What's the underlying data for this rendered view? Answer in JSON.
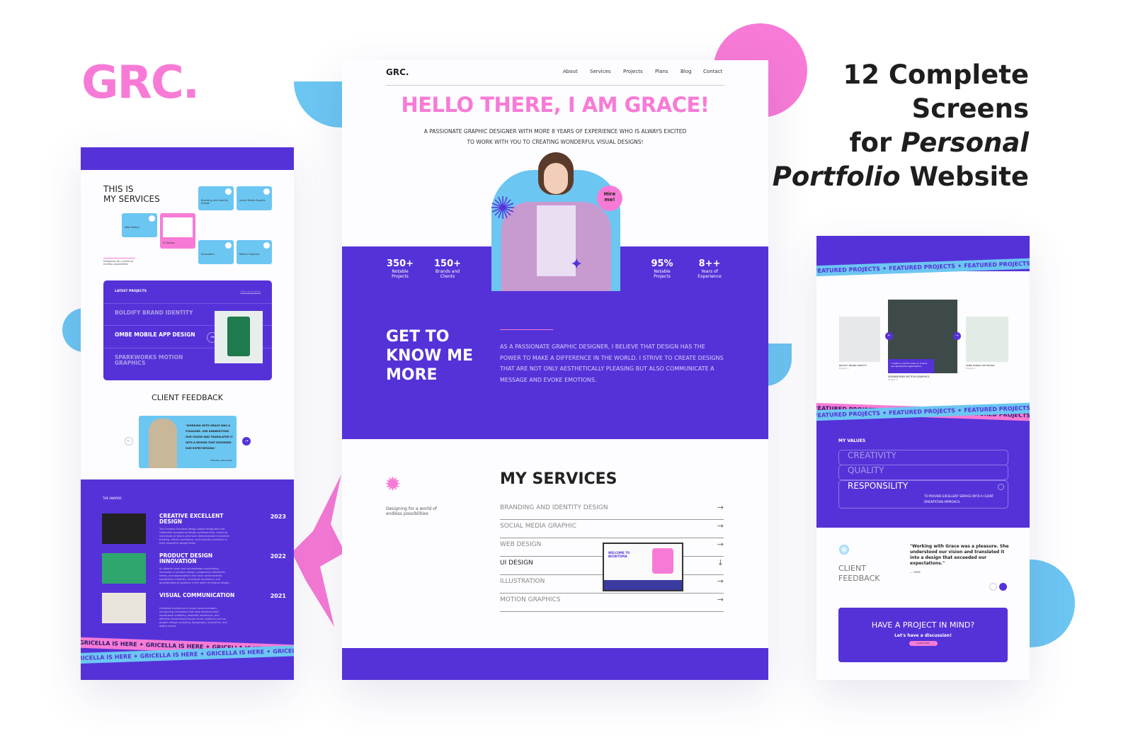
{
  "brand": {
    "logo": "GRC.",
    "headline_line1": "12 Complete",
    "headline_line2": "Screens",
    "headline_line3_pre": "for ",
    "headline_line3_em": "Personal",
    "headline_line4_em": "Portfolio",
    "headline_line4_post": " Website"
  },
  "colors": {
    "purple": "#5532d8",
    "pink": "#f77bd6",
    "blue": "#6cc6f2"
  },
  "left": {
    "services_title_1": "THIS IS",
    "services_title_2": "MY SERVICES",
    "tiles": [
      "Branding and Identity Design",
      "Social Media Graphic",
      "Web Design",
      "UI Design",
      "Illustration",
      "Motion Graphics"
    ],
    "tagline": "Designing for a world of endless possibilities",
    "latest_label": "LATEST PROJECTS",
    "view_all": "View all projects",
    "projects": [
      "BOLDIFY BRAND IDENTITY",
      "OMBE MOBILE APP DESIGN",
      "SPARKWORKS MOTION GRAPHICS"
    ],
    "feedback_title": "CLIENT FEEDBACK",
    "quote": "\"WORKING WITH GRACE WAS A PLEASURE. SHE UNDERSTOOD OUR VISION AND TRANSLATED IT INTO A DESIGN THAT EXCEEDED OUR EXPECTATIONS.\"",
    "quote_author": "Michelle, CEO Ombe",
    "awards_label": "THE AWARDS",
    "awards": [
      {
        "title": "CREATIVE EXCELLENT DESIGN",
        "year": "2023",
        "desc": "The Creative Excellent Design award recognizes and celebrates exceptional design achievements, honoring individuals or teams who have demonstrated innovative thinking, artistic excellence, and impactful solutions in their respective design fields."
      },
      {
        "title": "PRODUCT DESIGN INNOVATION",
        "year": "2022",
        "desc": "An Awards honor and acknowledge outstanding innovation in product design, recognizing individuals, teams, and organizations that have demonstrated exceptional creativity, functional excellence, and groundbreaking solutions in the realm of product design."
      },
      {
        "title": "VISUAL COMMUNICATION",
        "year": "2021",
        "desc": "Celebrate excellence in visual communication, recognizing individuals that have demonstrated exceptional creativity, aesthetic excellence, and effective storytelling through visual mediums such as graphic design, branding, typography, illustration, and digital media."
      }
    ],
    "ribbon": "GRICELLA IS HERE ✦ GRICELLA IS HERE ✦ GRICELLA IS HERE ✦ GRICELLA IS HERE"
  },
  "center": {
    "logo": "GRC.",
    "nav": [
      "About",
      "Services",
      "Projects",
      "Plans",
      "Blog",
      "Contact"
    ],
    "hero_title": "HELLO THERE, I AM GRACE!",
    "hero_sub_1": "A PASSIONATE GRAPHIC DESIGNER WITH MORE 8 YEARS OF EXPERIENCE WHO IS ALWAYS EXCITED",
    "hero_sub_2": "TO WORK WITH YOU TO CREATING WONDERFUL VISUAL DESIGNS!",
    "hire": "Hire me!",
    "stats": [
      {
        "value": "350+",
        "label": "Notable Projects"
      },
      {
        "value": "150+",
        "label": "Brands and Clients"
      },
      {
        "value": "95%",
        "label": "Notable Projects"
      },
      {
        "value": "8++",
        "label": "Years of Experience"
      }
    ],
    "about_title": "GET TO KNOW ME MORE",
    "about_text": "AS A PASSIONATE GRAPHIC DESIGNER, I BELIEVE THAT DESIGN HAS THE POWER TO MAKE A DIFFERENCE IN THE WORLD. I STRIVE TO CREATE DESIGNS THAT ARE NOT ONLY AESTHETICALLY PLEASING BUT ALSO COMMUNICATE A MESSAGE AND EVOKE EMOTIONS.",
    "services_title": "MY SERVICES",
    "services_tagline": "Designing for a world of endless possibilities",
    "services": [
      "BRANDING AND IDENTITY DESIGN",
      "SOCIAL MEDIA GRAPHIC",
      "WEB DESIGN",
      "UI DESIGN",
      "ILLUSTRATION",
      "MOTION GRAPHICS"
    ],
    "preview_title": "WELCOME TO BOOKTOPIA"
  },
  "right": {
    "ribbon": "FEATURED PROJECTS ✦ FEATURED PROJECTS ✦ FEATURED PROJECTS ✦ FEATURED PROJECTS",
    "featured": [
      {
        "name": "BOLDIFY BRAND IDENTITY",
        "sub": "Project 1"
      },
      {
        "name": "SPARKWORKS MOTION GRAPHICS",
        "sub": "Project 3"
      },
      {
        "name": "OMBE MOBILE APP DESIGN",
        "sub": "Project 2"
      }
    ],
    "featured_caption": "I create a colorful video on how to use Sparkworks applications.",
    "values_label": "MY VALUES",
    "values": [
      "CREATIVITY",
      "QUALITY",
      "RESPONSILITY"
    ],
    "value_desc": "TO PROVIDE EXCELLENT SERVICE WITH A CLIENT ORIENTATION APPROACH.",
    "feedback_title": "CLIENT FEEDBACK",
    "quote": "\"Working with Grace was a pleasure. She understood our vision and translated it into a design that exceeded our expectations.\"",
    "quote_author": "OMBE",
    "cta_title": "HAVE A PROJECT IN MIND?",
    "cta_sub": "Let's have a discussion!",
    "cta_button": "Contact Me!"
  }
}
